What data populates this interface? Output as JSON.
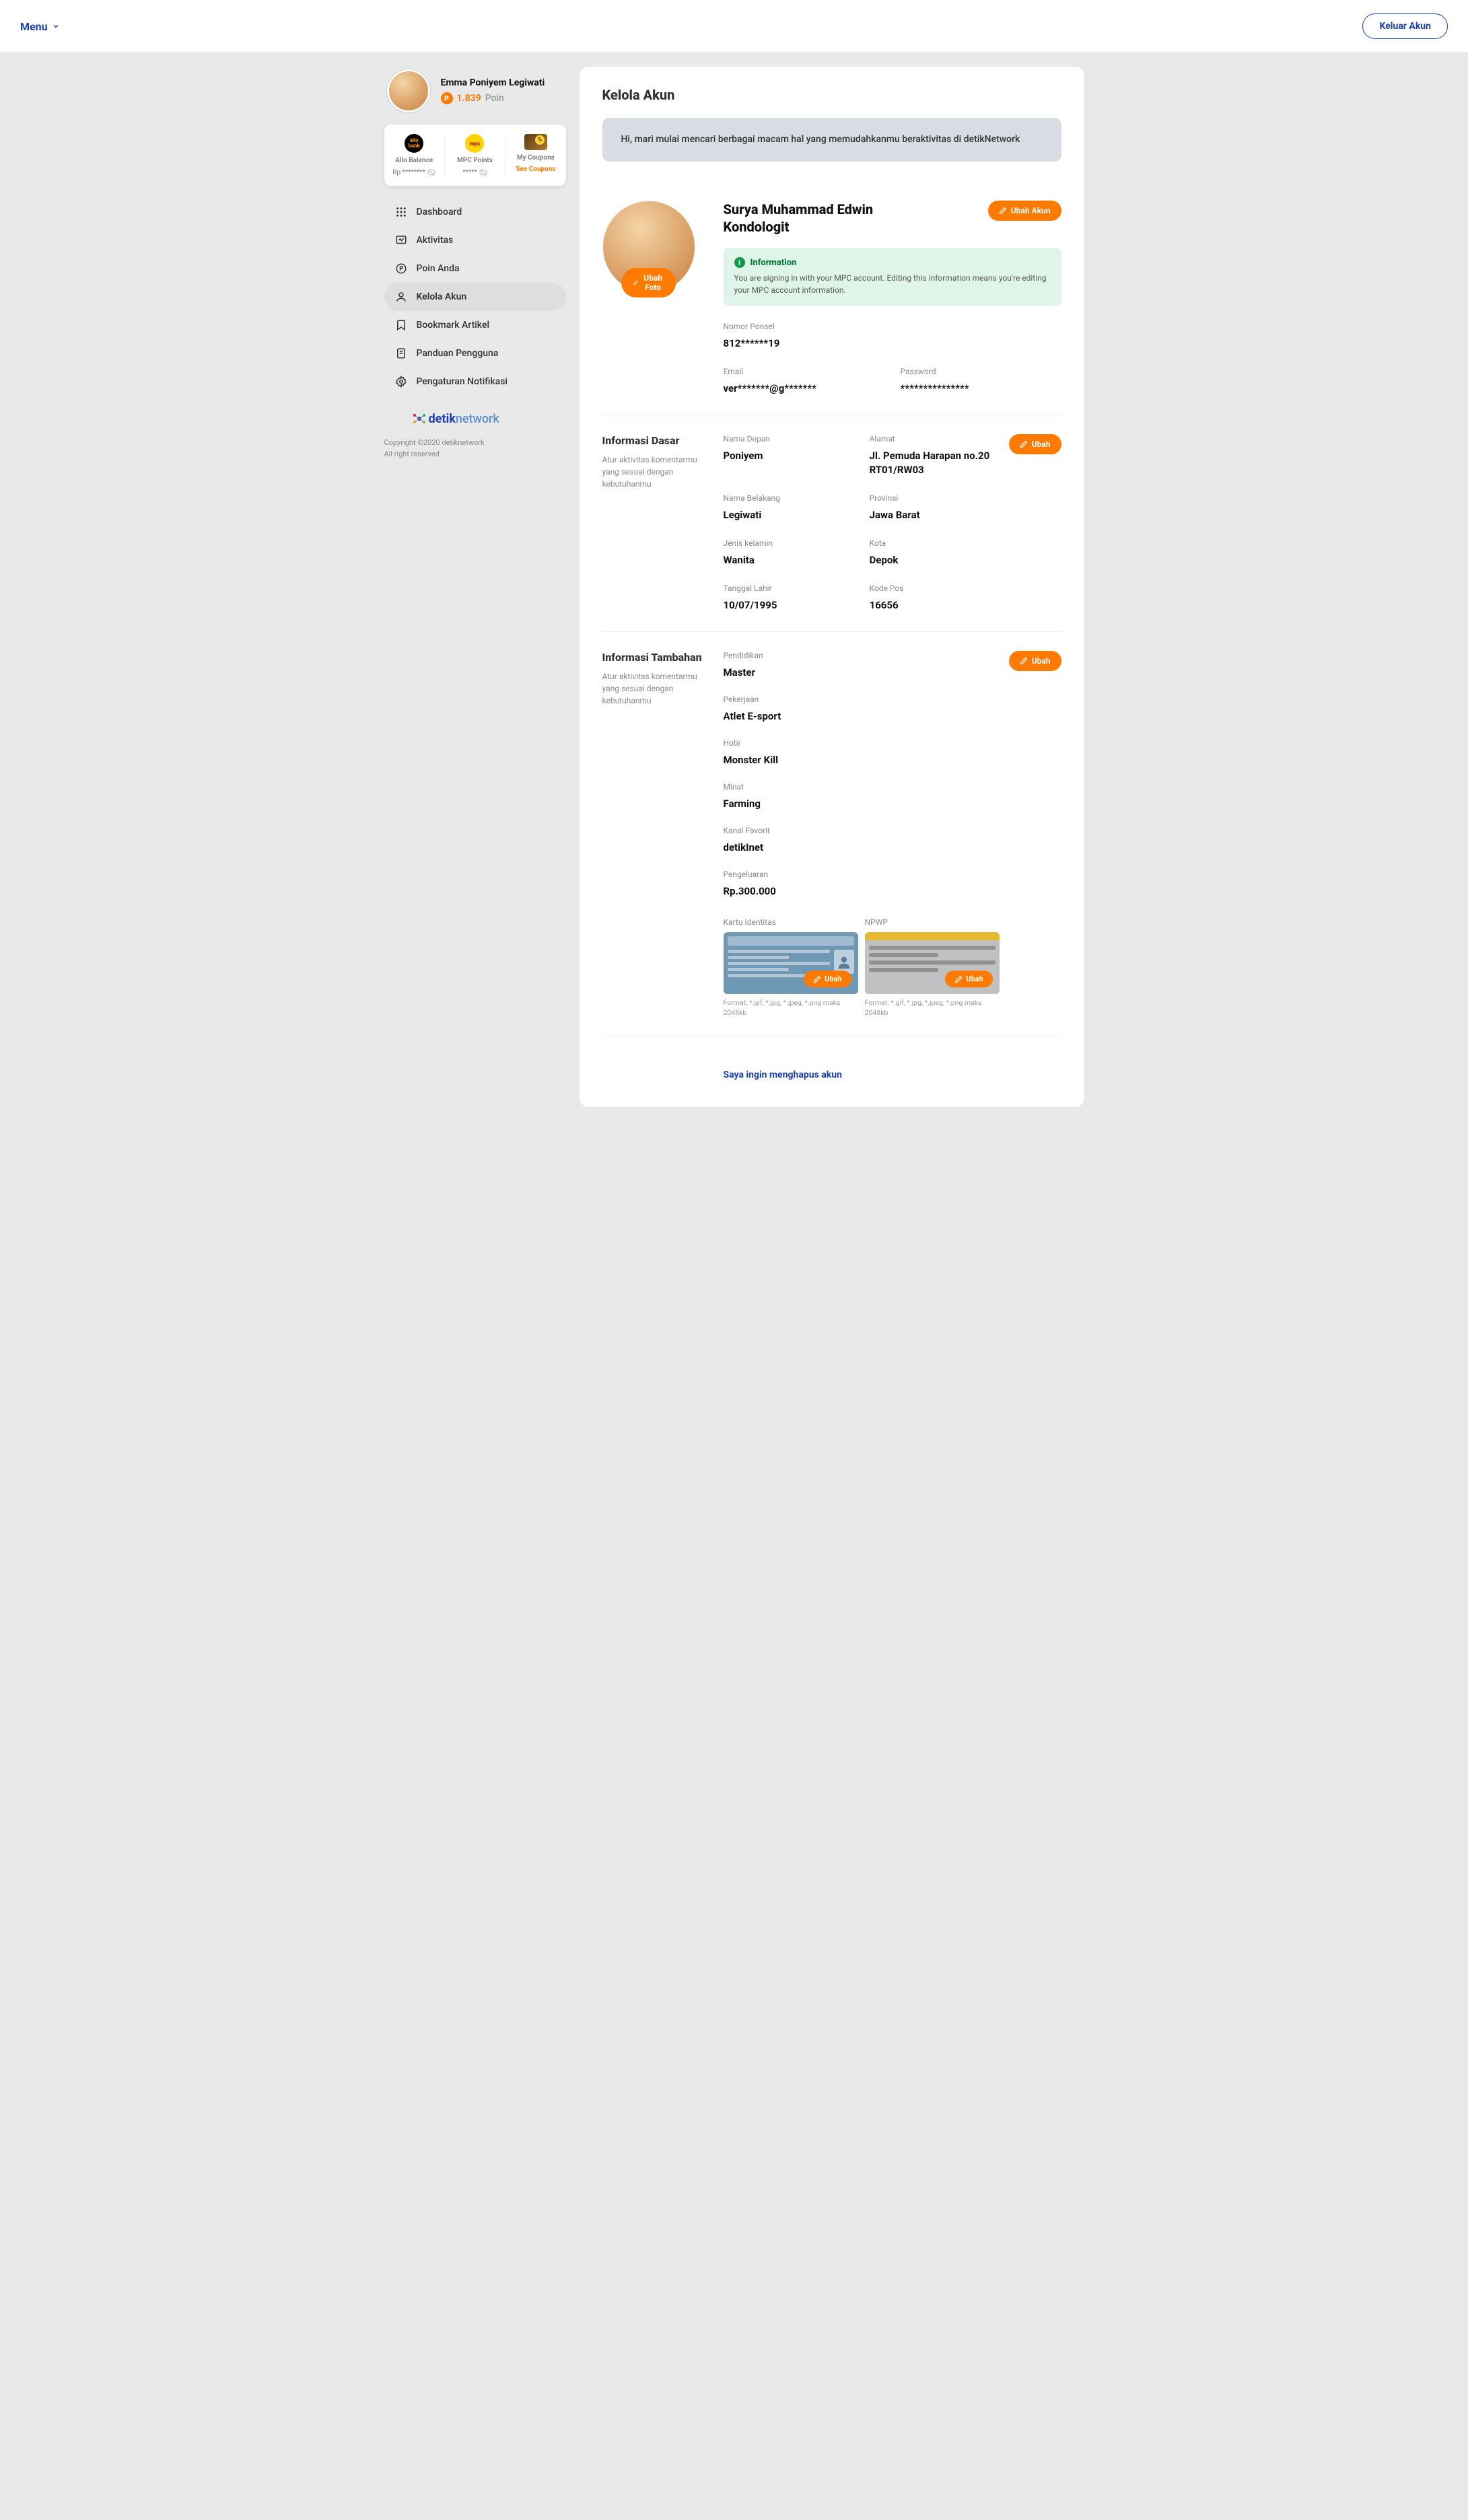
{
  "topbar": {
    "menu": "Menu",
    "logout": "Keluar Akun"
  },
  "profile": {
    "name": "Emma Poniyem Legiwati",
    "points": "1.839",
    "points_label": "Poin"
  },
  "wallet": {
    "allo": {
      "label": "Allo Balance",
      "value": "Rp ********"
    },
    "mpc": {
      "label": "MPC Points",
      "value": "*****"
    },
    "coupons": {
      "label": "My Coupons",
      "link": "See Coupons"
    }
  },
  "nav": {
    "dashboard": "Dashboard",
    "aktivitas": "Aktivitas",
    "poin": "Poin Anda",
    "kelola": "Kelola Akun",
    "bookmark": "Bookmark Artikel",
    "panduan": "Panduan Pengguna",
    "notifikasi": "Pengaturan Notifikasi"
  },
  "footer": {
    "copyright": "Copyright ©2020 detiknetwork",
    "rights": "All right reserved"
  },
  "page": {
    "title": "Kelola Akun",
    "banner": "Hi, mari mulai mencari berbagai macam hal yang memudahkanmu beraktivitas di detikNetwork",
    "edit_photo": "Ubah Foto",
    "edit_account": "Ubah Akun",
    "edit": "Ubah",
    "account_name": "Surya Muhammad Edwin Kondologit",
    "alert": {
      "title": "Information",
      "body": "You are signing in with your MPC account. Editing this information means you're editing your MPC account information."
    },
    "contact": {
      "phone_label": "Nomor Ponsel",
      "phone": "812******19",
      "email_label": "Email",
      "email": "ver*******@g*******",
      "password_label": "Password",
      "password": "***************"
    },
    "basic": {
      "title": "Informasi Dasar",
      "sub": "Atur aktivitas komentarmu yang sesuai dengan kebutuhanmu",
      "first_label": "Nama Depan",
      "first": "Poniyem",
      "last_label": "Nama Belakang",
      "last": "Legiwati",
      "gender_label": "Jenis kelamin",
      "gender": "Wanita",
      "dob_label": "Tanggal Lahir",
      "dob": "10/07/1995",
      "address_label": "Alamat",
      "address": "Jl. Pemuda Harapan no.20 RT01/RW03",
      "province_label": "Provinsi",
      "province": "Jawa Barat",
      "city_label": "Kota",
      "city": "Depok",
      "zip_label": "Kode Pos",
      "zip": "16656"
    },
    "extra": {
      "title": "Informasi Tambahan",
      "sub": "Atur aktivitas komentarmu yang sesuai dengan kebutuhanmu",
      "edu_label": "Pendidikan",
      "edu": "Master",
      "job_label": "Pekerjaan",
      "job": "Atlet E-sport",
      "hobby_label": "Hobi",
      "hobby": "Monster Kill",
      "interest_label": "Minat",
      "interest": "Farming",
      "channel_label": "Kanal Favorit",
      "channel": "detikInet",
      "spend_label": "Pengeluaran",
      "spend": "Rp.300.000",
      "id_label": "Kartu Identitas",
      "npwp_label": "NPWP",
      "format": "Format: *.gif, *.jpg, *.jpeg, *.png maks 2048kb"
    },
    "delete": "Saya ingin menghapus akun"
  }
}
